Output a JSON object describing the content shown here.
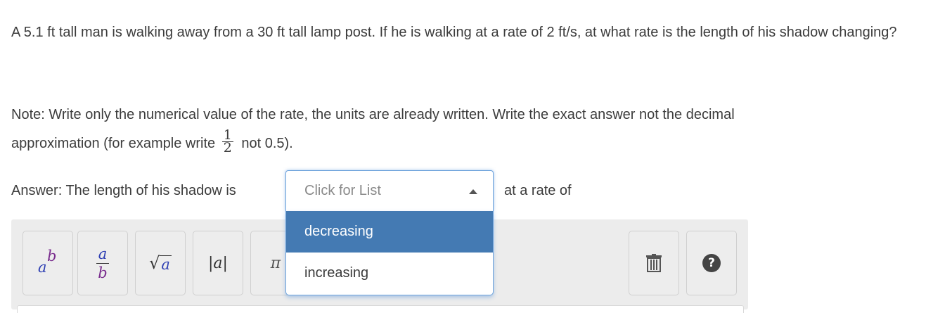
{
  "question": {
    "text": "A 5.1 ft tall man is walking away from a 30 ft tall lamp post.  If he is walking at a rate of 2 ft/s, at what rate is the length of his shadow changing?"
  },
  "note": {
    "line1": "Note: Write only the numerical value of the rate, the units are already written. Write the exact answer not the decimal",
    "line2_prefix": "approximation (for example write",
    "fraction_num": "1",
    "fraction_den": "2",
    "line2_suffix": "not 0.5)."
  },
  "answer": {
    "label": "Answer: The length of his shadow is",
    "after_label": "at a rate of"
  },
  "select": {
    "placeholder": "Click for List",
    "options": [
      "decreasing",
      "increasing"
    ],
    "highlighted": "decreasing"
  },
  "toolbar": {
    "pow_base": "a",
    "pow_exp": "b",
    "frac_num": "a",
    "frac_den": "b",
    "sqrt_arg": "a",
    "abs_text": "|a|",
    "pi_text": "π",
    "help_text": "?"
  },
  "icons": {
    "trash": "trash-icon",
    "help": "help-icon",
    "caret": "caret-up-icon"
  },
  "colors": {
    "accent": "#447ab3",
    "focus_ring": "#6ea3dc"
  }
}
